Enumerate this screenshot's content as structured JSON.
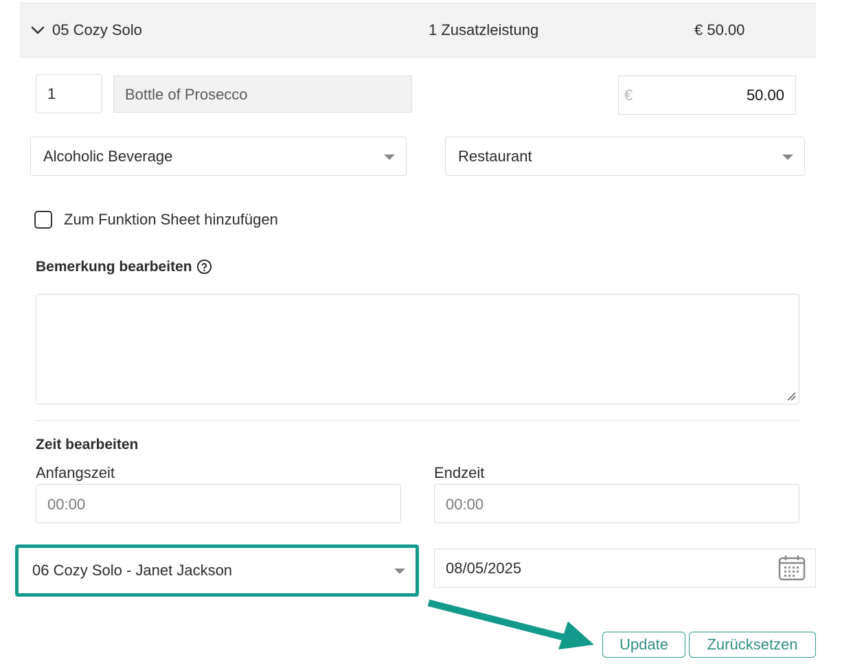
{
  "group": {
    "title": "05 Cozy Solo",
    "count": "1 Zusatzleistung",
    "total": "€ 50.00"
  },
  "item": {
    "quantity": "1",
    "name": "Bottle of Prosecco",
    "currency": "€",
    "price": "50.00",
    "category": "Alcoholic Beverage",
    "outlet": "Restaurant"
  },
  "function_sheet": {
    "label": "Zum Funktion Sheet hinzufügen",
    "checked": false
  },
  "remark": {
    "heading": "Bemerkung bearbeiten",
    "value": ""
  },
  "time": {
    "heading": "Zeit bearbeiten",
    "start_label": "Anfangszeit",
    "start_placeholder": "00:00",
    "end_label": "Endzeit",
    "end_placeholder": "00:00"
  },
  "booking": {
    "selected": "06 Cozy Solo - Janet Jackson"
  },
  "date": {
    "value": "08/05/2025"
  },
  "buttons": {
    "update": "Update",
    "reset": "Zurücksetzen"
  },
  "colors": {
    "accent": "#149a8b",
    "button_text": "#2f8e83",
    "header_bg": "#f3f3f3"
  },
  "icons": [
    "chevron-down-icon",
    "caret-down-icon",
    "help-circle-icon",
    "calendar-icon",
    "resize-grip-icon",
    "arrow-annotation"
  ]
}
